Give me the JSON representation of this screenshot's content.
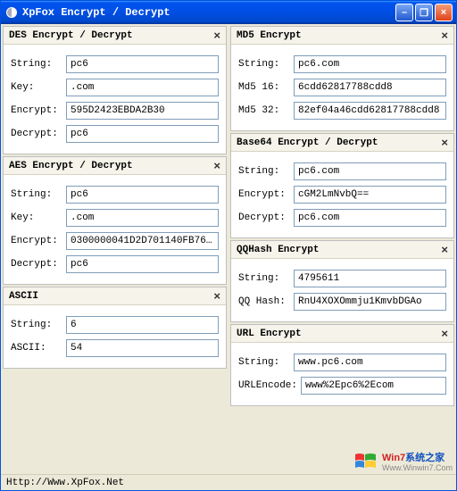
{
  "window": {
    "title": "XpFox Encrypt / Decrypt"
  },
  "footer": {
    "url": "Http://Www.XpFox.Net"
  },
  "panels": {
    "des": {
      "title": "DES  Encrypt / Decrypt",
      "string_label": "String:",
      "string_value": "pc6",
      "key_label": "Key:",
      "key_value": ".com",
      "encrypt_label": "Encrypt:",
      "encrypt_value": "595D2423EBDA2B30",
      "decrypt_label": "Decrypt:",
      "decrypt_value": "pc6"
    },
    "aes": {
      "title": "AES  Encrypt / Decrypt",
      "string_label": "String:",
      "string_value": "pc6",
      "key_label": "Key:",
      "key_value": ".com",
      "encrypt_label": "Encrypt:",
      "encrypt_value": "0300000041D2D701140FB76…",
      "decrypt_label": "Decrypt:",
      "decrypt_value": "pc6"
    },
    "ascii": {
      "title": "ASCII",
      "string_label": "String:",
      "string_value": "6",
      "ascii_label": "ASCII:",
      "ascii_value": "54"
    },
    "md5": {
      "title": "MD5 Encrypt",
      "string_label": "String:",
      "string_value": "pc6.com",
      "md516_label": "Md5 16:",
      "md516_value": "6cdd62817788cdd8",
      "md532_label": "Md5 32:",
      "md532_value": "82ef04a46cdd62817788cdd8"
    },
    "base64": {
      "title": "Base64  Encrypt / Decrypt",
      "string_label": "String:",
      "string_value": "pc6.com",
      "encrypt_label": "Encrypt:",
      "encrypt_value": "cGM2LmNvbQ==",
      "decrypt_label": "Decrypt:",
      "decrypt_value": "pc6.com"
    },
    "qqhash": {
      "title": "QQHash Encrypt",
      "string_label": "String:",
      "string_value": "4795611",
      "qqhash_label": "QQ Hash:",
      "qqhash_value": "RnU4XOXOmmju1KmvbDGAo"
    },
    "url": {
      "title": "URL Encrypt",
      "string_label": "String:",
      "string_value": "www.pc6.com",
      "urlenc_label": "URLEncode:",
      "urlenc_value": "www%2Epc6%2Ecom"
    }
  },
  "watermark": {
    "brand1": "Win7",
    "brand2": "系统之家",
    "sub": "Www.Winwin7.Com"
  }
}
